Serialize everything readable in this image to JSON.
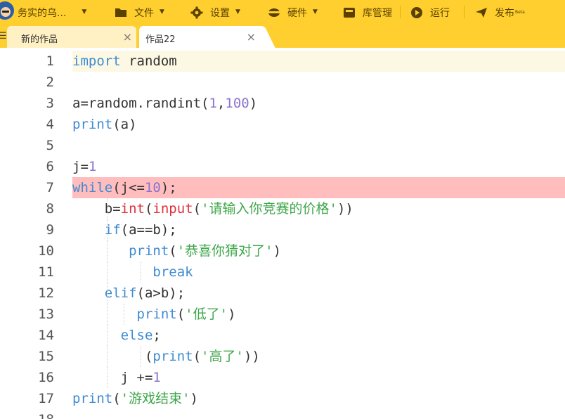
{
  "menubar": {
    "project_name": "务实的乌...",
    "items": [
      {
        "id": "file",
        "label": "文件",
        "icon": "folder-icon",
        "has_caret": true
      },
      {
        "id": "settings",
        "label": "设置",
        "icon": "gear-icon",
        "has_caret": true
      },
      {
        "id": "hardware",
        "label": "硬件",
        "icon": "hardware-icon",
        "has_caret": true
      },
      {
        "id": "library",
        "label": "库管理",
        "icon": "library-icon",
        "has_caret": false
      },
      {
        "id": "run",
        "label": "运行",
        "icon": "play-icon",
        "has_caret": false
      },
      {
        "id": "publish",
        "label": "发布",
        "icon": "send-icon",
        "has_caret": false,
        "superscript": "Beta"
      }
    ]
  },
  "tabs": [
    {
      "label": "新的作品",
      "active": false
    },
    {
      "label": "作品22",
      "active": true
    }
  ],
  "editor": {
    "line_numbers": [
      "1",
      "2",
      "3",
      "4",
      "5",
      "6",
      "7",
      "8",
      "9",
      "10",
      "11",
      "12",
      "13",
      "14",
      "15",
      "16",
      "17",
      "18"
    ],
    "current_line": 1,
    "error_line": 7,
    "lines": [
      [
        [
          "kw",
          "import"
        ],
        [
          "plain",
          " random"
        ]
      ],
      [],
      [
        [
          "plain",
          "a=random.randint("
        ],
        [
          "num",
          "1"
        ],
        [
          "plain",
          ","
        ],
        [
          "num",
          "100"
        ],
        [
          "plain",
          ")"
        ]
      ],
      [
        [
          "builtin",
          "print"
        ],
        [
          "plain",
          "(a)"
        ]
      ],
      [],
      [
        [
          "plain",
          "j="
        ],
        [
          "num",
          "1"
        ]
      ],
      [
        [
          "kw",
          "while"
        ],
        [
          "plain",
          "(j<="
        ],
        [
          "num",
          "10"
        ],
        [
          "plain",
          ");"
        ]
      ],
      [
        [
          "plain",
          "    b="
        ],
        [
          "red",
          "int"
        ],
        [
          "plain",
          "("
        ],
        [
          "red",
          "input"
        ],
        [
          "plain",
          "("
        ],
        [
          "str",
          "'请输入你竞赛的价格'"
        ],
        [
          "plain",
          "))"
        ]
      ],
      [
        [
          "plain",
          "    "
        ],
        [
          "kw",
          "if"
        ],
        [
          "plain",
          "(a==b);"
        ]
      ],
      [
        [
          "plain",
          "       "
        ],
        [
          "builtin",
          "print"
        ],
        [
          "plain",
          "("
        ],
        [
          "str",
          "'恭喜你猜对了'"
        ],
        [
          "plain",
          ")"
        ]
      ],
      [
        [
          "plain",
          "          "
        ],
        [
          "kw",
          "break"
        ]
      ],
      [
        [
          "plain",
          "    "
        ],
        [
          "kw",
          "elif"
        ],
        [
          "plain",
          "(a>b);"
        ]
      ],
      [
        [
          "plain",
          "        "
        ],
        [
          "builtin",
          "print"
        ],
        [
          "plain",
          "("
        ],
        [
          "str",
          "'低了'"
        ],
        [
          "plain",
          ")"
        ]
      ],
      [
        [
          "plain",
          "      "
        ],
        [
          "kw",
          "else"
        ],
        [
          "plain",
          ";"
        ]
      ],
      [
        [
          "plain",
          "         ("
        ],
        [
          "builtin",
          "print"
        ],
        [
          "plain",
          "("
        ],
        [
          "str",
          "'高了'"
        ],
        [
          "plain",
          "))"
        ]
      ],
      [
        [
          "plain",
          "      j +="
        ],
        [
          "num",
          "1"
        ]
      ],
      [
        [
          "builtin",
          "print"
        ],
        [
          "plain",
          "("
        ],
        [
          "str",
          "'游戏结束'"
        ],
        [
          "plain",
          ")"
        ]
      ],
      []
    ]
  }
}
